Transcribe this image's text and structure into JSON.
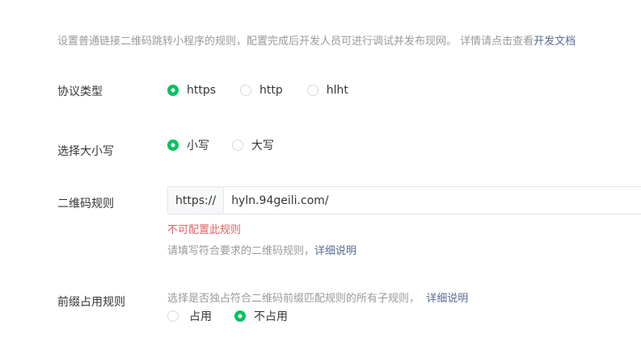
{
  "intro": {
    "text": "设置普通链接二维码跳转小程序的规则，配置完成后开发人员可进行调试并发布现网。 详情请点击查看",
    "link": "开发文档"
  },
  "protocol": {
    "label": "协议类型",
    "options": [
      "https",
      "http",
      "hlht"
    ],
    "selected": "https"
  },
  "case": {
    "label": "选择大小写",
    "options": [
      "小写",
      "大写"
    ],
    "selected": "小写"
  },
  "qr_rule": {
    "label": "二维码规则",
    "prefix": "https://",
    "value": "hyln.94geili.com/",
    "error": "不可配置此规则",
    "help_text": "请填写符合要求的二维码规则，",
    "help_link": "详细说明"
  },
  "prefix_rule": {
    "label": "前缀占用规则",
    "help_text": "选择是否独占符合二维码前缀匹配规则的所有子规则，",
    "help_link": "详细说明",
    "options": [
      "占用",
      "不占用"
    ],
    "selected": "不占用"
  }
}
